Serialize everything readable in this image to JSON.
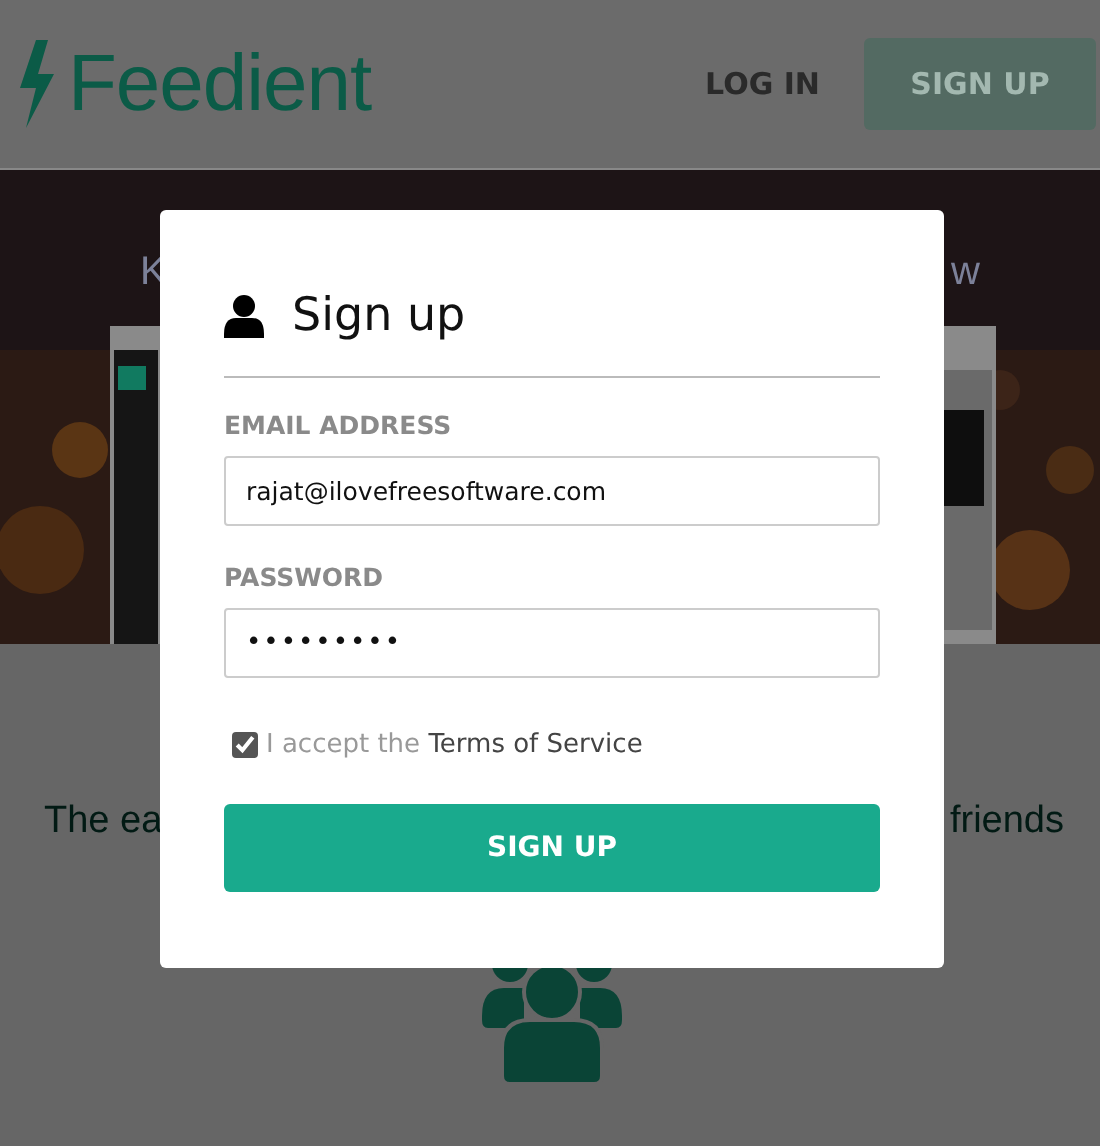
{
  "header": {
    "logo": "Feedient",
    "login": "LOG IN",
    "signup": "SIGN UP"
  },
  "hero": {
    "text_left": "K",
    "text_right": "w"
  },
  "tagline": {
    "left": "The ea",
    "right": "friends"
  },
  "dialog": {
    "title": "Sign up",
    "fields": [
      {
        "label": "EMAIL ADDRESS",
        "value": "rajat@ilovefreesoftware.com",
        "kind": "text"
      },
      {
        "label": "PASSWORD",
        "value": "•••••••••",
        "kind": "password"
      }
    ],
    "terms": {
      "checked": true,
      "prefix": "I accept the",
      "link": "Terms of Service"
    },
    "submit": "SIGN UP"
  }
}
